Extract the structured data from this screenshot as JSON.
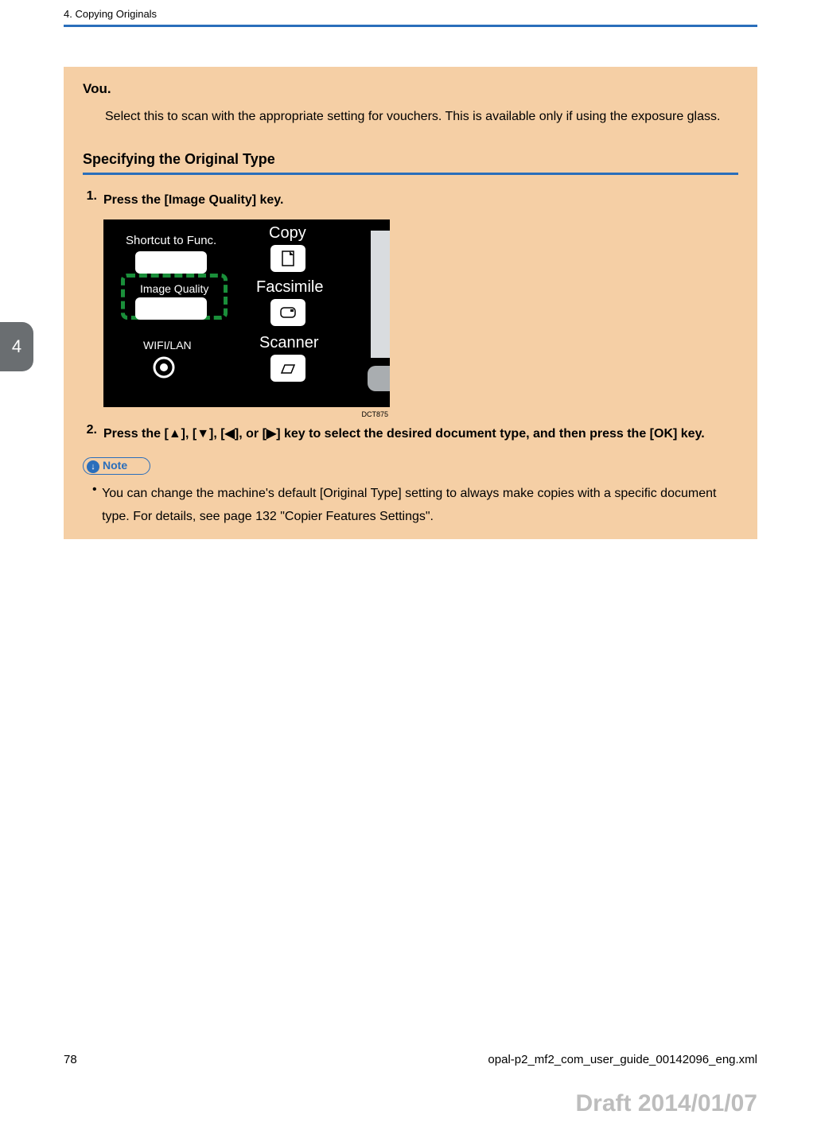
{
  "header": {
    "chapter": "4. Copying Originals"
  },
  "sidetab": {
    "num": "4"
  },
  "vou": {
    "title": "Vou.",
    "desc": "Select this to scan with the appropriate setting for vouchers. This is available only if using the exposure glass."
  },
  "section": {
    "heading": "Specifying the Original Type"
  },
  "step1": {
    "num": "1.",
    "text": "Press the [Image Quality] key."
  },
  "panel": {
    "shortcut": "Shortcut to Func.",
    "image_quality": "Image Quality",
    "wifi": "WIFI/LAN",
    "copy": "Copy",
    "facsimile": "Facsimile",
    "scanner": "Scanner"
  },
  "figref": "DCT875",
  "step2": {
    "num": "2.",
    "prefix": "Press the [",
    "mid1": "], [",
    "mid2": "], [",
    "mid3": "], or [",
    "suffix": "] key to select the desired document type, and then press the [OK] key."
  },
  "note": {
    "badge": "Note",
    "text": "You can change the machine's default [Original Type] setting to always make copies with a specific document type. For details, see page 132 \"Copier Features Settings\"."
  },
  "footer": {
    "page": "78",
    "file": "opal-p2_mf2_com_user_guide_00142096_eng.xml"
  },
  "draft": "Draft 2014/01/07"
}
